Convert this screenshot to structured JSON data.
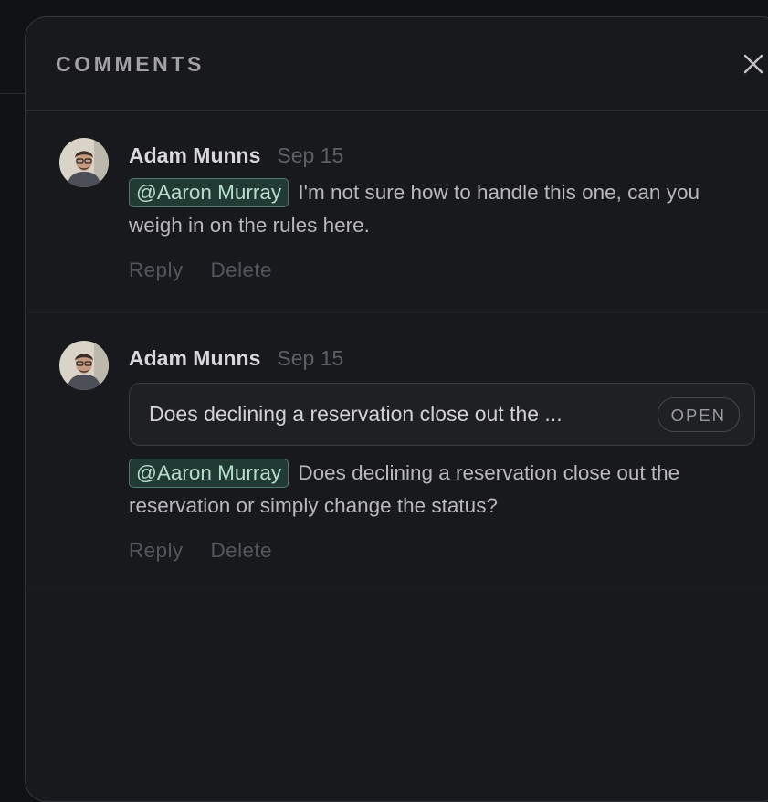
{
  "panel": {
    "title": "COMMENTS",
    "close_icon": "close-icon"
  },
  "comments": [
    {
      "author": "Adam Munns",
      "date": "Sep 15",
      "avatar_icon": "avatar",
      "mention": "@Aaron Murray",
      "text": "I'm not sure how to handle this one, can you weigh in on the rules here.",
      "reply_label": "Reply",
      "delete_label": "Delete"
    },
    {
      "author": "Adam Munns",
      "date": "Sep 15",
      "avatar_icon": "avatar",
      "thread": {
        "title": "Does declining a reservation close out the ...",
        "status": "OPEN"
      },
      "mention": "@Aaron Murray",
      "text": "Does declining a reservation close out the reservation or simply change the status?",
      "reply_label": "Reply",
      "delete_label": "Delete"
    }
  ],
  "colors": {
    "background": "#111216",
    "panel": "#18191d",
    "mention_bg": "#213a33",
    "mention_border": "#53786b",
    "mention_text": "#b8dccd"
  }
}
